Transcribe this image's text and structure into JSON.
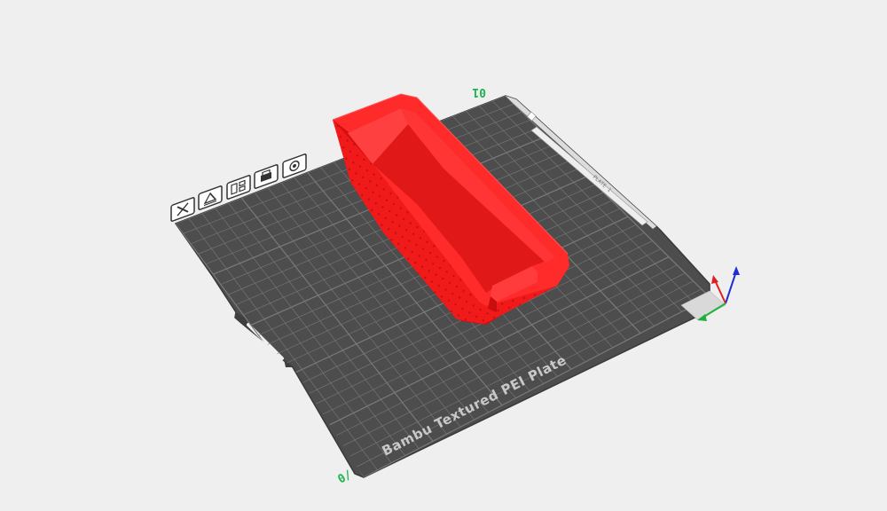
{
  "viewport": {
    "background": "#efefef",
    "object_color": "#ff2222",
    "plate_color": "#4d4d4d"
  },
  "plate": {
    "name": "Bambu Textured PEI Plate",
    "label_x_origin": "0/",
    "label_far_corner": "01",
    "plate_id_text": "PLATE 1"
  },
  "plate_toolbar": {
    "icons": [
      {
        "name": "close-plate-icon"
      },
      {
        "name": "auto-orient-icon"
      },
      {
        "name": "arrange-icon"
      },
      {
        "name": "lock-plate-icon"
      },
      {
        "name": "plate-settings-icon"
      }
    ]
  },
  "axes": {
    "x_color": "#e02020",
    "y_color": "#20b040",
    "z_color": "#2030d0"
  }
}
